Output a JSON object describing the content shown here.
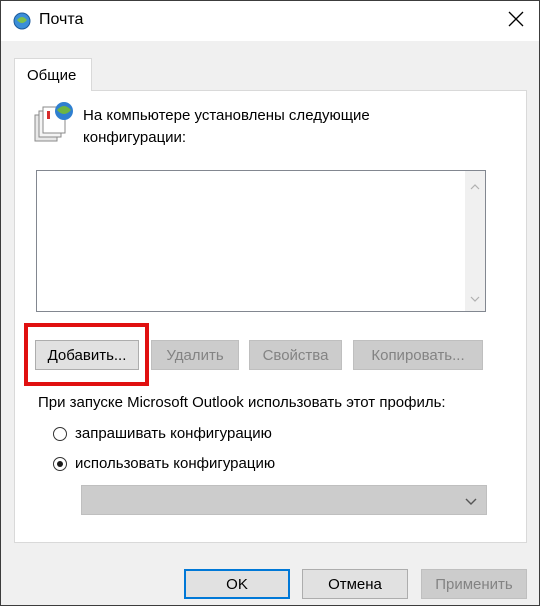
{
  "window": {
    "title": "Почта"
  },
  "tabs": [
    {
      "label": "Общие"
    }
  ],
  "info": {
    "text": "На компьютере установлены следующие конфигурации:"
  },
  "profiles_list": {
    "items": []
  },
  "buttons": {
    "add": "Добавить...",
    "remove": "Удалить",
    "properties": "Свойства",
    "copy": "Копировать..."
  },
  "startup": {
    "label": "При запуске Microsoft Outlook использовать этот профиль:",
    "options": [
      {
        "label": "запрашивать конфигурацию",
        "selected": false
      },
      {
        "label": "использовать конфигурацию",
        "selected": true
      }
    ],
    "selected_profile": ""
  },
  "footer": {
    "ok": "OK",
    "cancel": "Отмена",
    "apply": "Применить"
  },
  "colors": {
    "highlight": "#e01010",
    "focus_border": "#0078d7",
    "disabled_text": "#838383"
  },
  "icons": [
    "mail-app-icon",
    "close-icon",
    "mail-config-icon",
    "scroll-up-icon",
    "scroll-down-icon",
    "chevron-down-icon"
  ]
}
